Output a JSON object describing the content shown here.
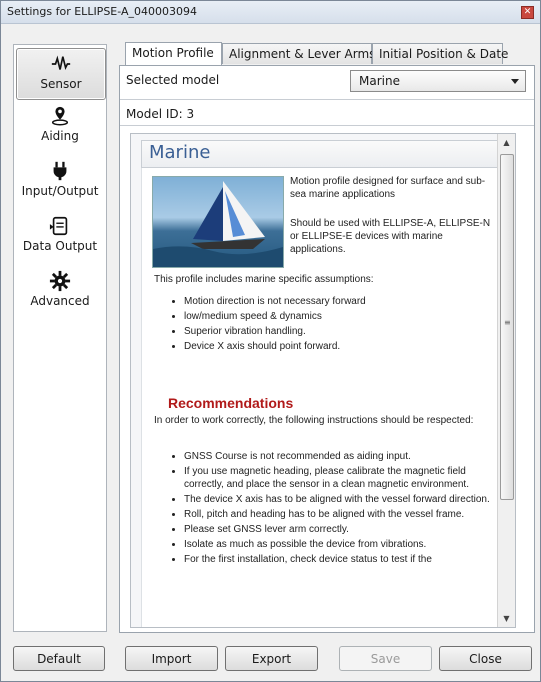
{
  "window": {
    "title": "Settings for ELLIPSE-A_040003094"
  },
  "sidebar": {
    "items": [
      {
        "label": "Sensor",
        "icon": "sensor-wave-icon",
        "active": true
      },
      {
        "label": "Aiding",
        "icon": "location-pin-icon",
        "active": false
      },
      {
        "label": "Input/Output",
        "icon": "plug-icon",
        "active": false
      },
      {
        "label": "Data Output",
        "icon": "data-output-icon",
        "active": false
      },
      {
        "label": "Advanced",
        "icon": "gear-icon",
        "active": false
      }
    ]
  },
  "tabs": [
    {
      "label": "Motion Profile",
      "active": true
    },
    {
      "label": "Alignment & Lever Arms",
      "active": false
    },
    {
      "label": "Initial Position & Date",
      "active": false
    }
  ],
  "motion_profile": {
    "selected_model_label": "Selected model",
    "selected_model_value": "Marine",
    "model_id": "Model ID: 3"
  },
  "doc": {
    "heading": "Marine",
    "intro_1": "Motion profile designed for surface and sub-sea marine applications",
    "intro_2": "Should be used with ELLIPSE-A, ELLIPSE-N or ELLIPSE-E devices with marine applications.",
    "assumptions_intro": "This profile includes marine specific assumptions:",
    "assumptions": [
      "Motion direction is not necessary forward",
      "low/medium speed & dynamics",
      "Superior vibration handling.",
      "Device X axis should point forward."
    ],
    "recommendations_heading": "Recommendations",
    "recommendations_intro": "In order to work correctly, the following instructions should be respected:",
    "recommendations": [
      "GNSS Course is not recommended as aiding input.",
      "If you use magnetic heading, please calibrate the magnetic field correctly, and place the sensor in a clean magnetic environment.",
      "The device X axis has to be aligned with the vessel forward direction.",
      "Roll, pitch and heading has to be aligned with the vessel frame.",
      "Please set GNSS lever arm correctly.",
      "Isolate as much as possible the device from vibrations.",
      "For the first installation, check device status to test if the"
    ]
  },
  "buttons": {
    "default": "Default",
    "import": "Import",
    "export": "Export",
    "save": "Save",
    "close": "Close"
  }
}
